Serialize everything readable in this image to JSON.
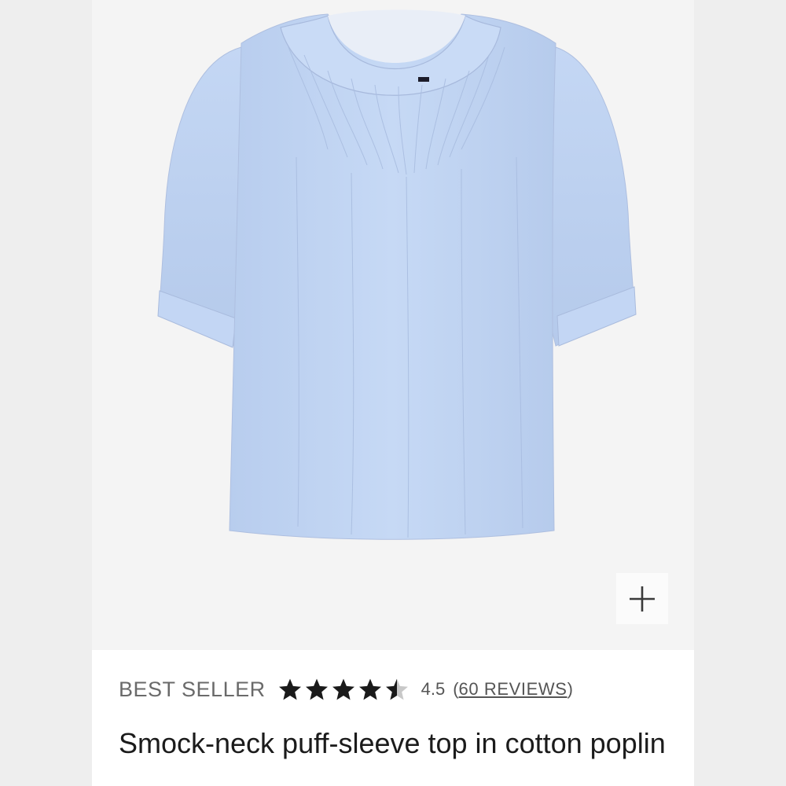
{
  "product": {
    "badge": "BEST SELLER",
    "rating_value": "4.5",
    "rating": 4.5,
    "rating_max": 5,
    "reviews_open": "(",
    "reviews_label": "60 REVIEWS",
    "reviews_close": ")",
    "title": "Smock-neck puff-sleeve top in cotton poplin"
  },
  "image": {
    "subject": "light blue smock-neck puff-sleeve blouse",
    "garment_color": "#c2d6f3",
    "background_color": "#f4f4f4"
  },
  "controls": {
    "zoom_icon": "plus-icon"
  },
  "colors": {
    "star": "#1a1a1a",
    "text_muted": "#6a6a6a",
    "title": "#1b1b1b"
  }
}
